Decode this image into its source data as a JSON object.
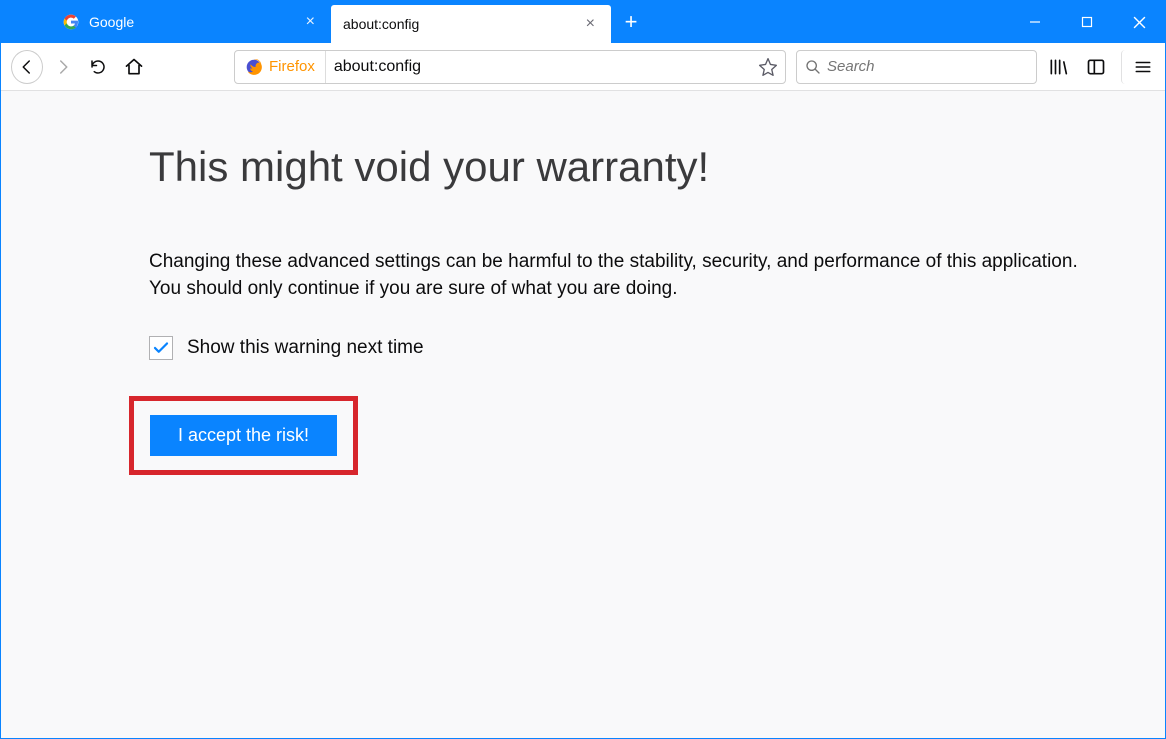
{
  "tabs": {
    "google": {
      "label": "Google"
    },
    "config": {
      "label": "about:config"
    }
  },
  "toolbar": {
    "identity_label": "Firefox",
    "url_value": "about:config",
    "search_placeholder": "Search"
  },
  "content": {
    "title": "This might void your warranty!",
    "body": "Changing these advanced settings can be harmful to the stability, security, and performance of this application. You should only continue if you are sure of what you are doing.",
    "checkbox_label": "Show this warning next time",
    "accept_label": "I accept the risk!"
  }
}
